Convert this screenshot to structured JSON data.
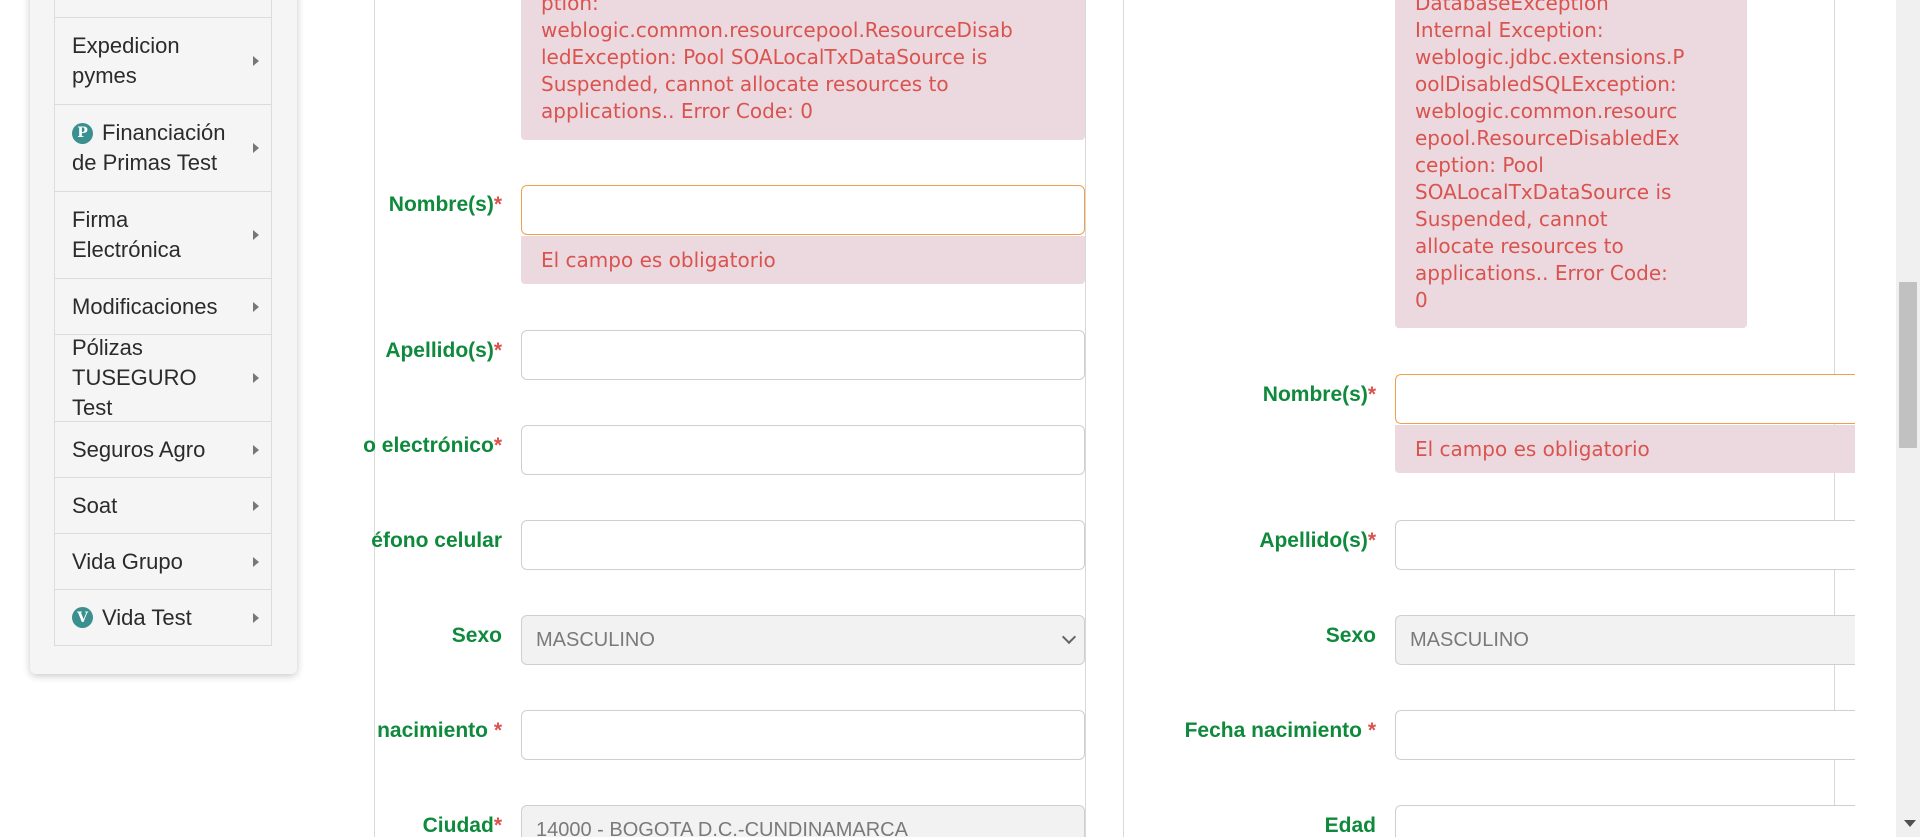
{
  "sidebar": {
    "items": [
      {
        "label": "Expedicion pymes",
        "badge": ""
      },
      {
        "label": "Financiación de Primas Test",
        "badge": "P"
      },
      {
        "label": "Firma Electrónica",
        "badge": ""
      },
      {
        "label": "Modificaciones",
        "badge": ""
      },
      {
        "label": "Pólizas TUSEGURO Test",
        "badge": ""
      },
      {
        "label": "Seguros Agro",
        "badge": ""
      },
      {
        "label": "Soat",
        "badge": ""
      },
      {
        "label": "Vida Grupo",
        "badge": ""
      },
      {
        "label": "Vida Test",
        "badge": "V"
      }
    ]
  },
  "left_form": {
    "error_lines": [
      "ption:",
      "weblogic.common.resourcepool.ResourceDisab",
      "ledException: Pool SOALocalTxDataSource is",
      "Suspended, cannot allocate resources to",
      "applications.. Error Code: 0"
    ],
    "fields": {
      "nombre": {
        "label": "Nombre(s)",
        "req": "*",
        "value": "",
        "message": "El campo es obligatorio"
      },
      "apellido": {
        "label": "Apellido(s)",
        "req": "*",
        "value": ""
      },
      "correo": {
        "label": "o electrónico",
        "req": "*",
        "value": ""
      },
      "telefono": {
        "label": "éfono celular",
        "req": "",
        "value": ""
      },
      "sexo": {
        "label": "Sexo",
        "req": "",
        "value": "MASCULINO"
      },
      "nacimiento": {
        "label": "nacimiento ",
        "req": "*",
        "value": ""
      },
      "ciudad": {
        "label": "Ciudad",
        "req": "*",
        "value": "14000 - BOGOTA D.C.-CUNDINAMARCA"
      }
    }
  },
  "right_form": {
    "error_lines": [
      "DatabaseException",
      "Internal Exception:",
      "weblogic.jdbc.extensions.P",
      "oolDisabledSQLException:",
      "weblogic.common.resourc",
      "epool.ResourceDisabledEx",
      "ception: Pool",
      "SOALocalTxDataSource is",
      "Suspended, cannot",
      "allocate resources to",
      "applications.. Error Code:",
      "0"
    ],
    "fields": {
      "nombre": {
        "label": "Nombre(s)",
        "req": "*",
        "value": "",
        "message": "El campo es obligatorio"
      },
      "apellido": {
        "label": "Apellido(s)",
        "req": "*",
        "value": ""
      },
      "sexo": {
        "label": "Sexo",
        "req": "",
        "value": "MASCULINO"
      },
      "nacimiento": {
        "label": "Fecha nacimiento ",
        "req": "*",
        "value": ""
      },
      "edad": {
        "label": "Edad",
        "req": "",
        "value": ""
      }
    }
  },
  "colors": {
    "label_green": "#0f8a3c",
    "error_red": "#d9534f",
    "error_bg": "#ecd9df",
    "focus_orange": "#f0a04b"
  },
  "icons": {
    "menu_arrow": "caret-right-icon",
    "select": "chevron-down-icon"
  }
}
